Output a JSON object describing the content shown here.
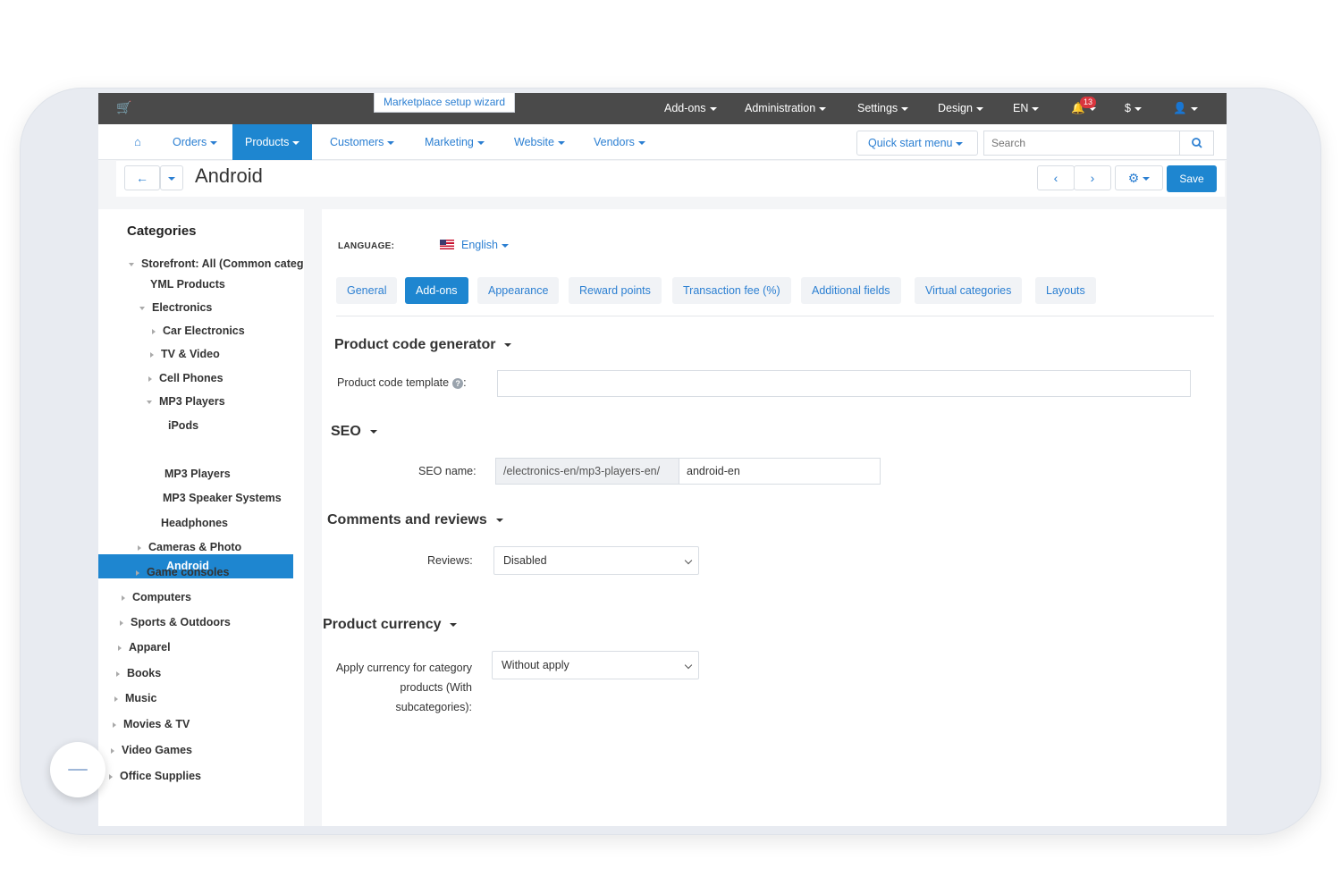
{
  "topbar": {
    "wizard": "Marketplace setup wizard",
    "menus": [
      "Add-ons",
      "Administration",
      "Settings",
      "Design",
      "EN"
    ],
    "notifications": "13",
    "currency": "$"
  },
  "nav": {
    "items": [
      "Orders",
      "Products",
      "Customers",
      "Marketing",
      "Website",
      "Vendors"
    ],
    "active": "Products",
    "quick_start": "Quick start menu",
    "search_placeholder": "Search"
  },
  "title": {
    "text": "Android",
    "save_label": "Save"
  },
  "sidebar": {
    "heading": "Categories",
    "items": [
      {
        "label": "Storefront: All (Common categ"
      },
      {
        "label": "YML Products"
      },
      {
        "label": "Electronics"
      },
      {
        "label": "Car Electronics"
      },
      {
        "label": "TV & Video"
      },
      {
        "label": "Cell Phones"
      },
      {
        "label": "MP3 Players"
      },
      {
        "label": "iPods"
      },
      {
        "label": "Android"
      },
      {
        "label": "MP3 Players"
      },
      {
        "label": "MP3 Speaker Systems"
      },
      {
        "label": "Headphones"
      },
      {
        "label": "Cameras & Photo"
      },
      {
        "label": "Game consoles"
      },
      {
        "label": "Computers"
      },
      {
        "label": "Sports & Outdoors"
      },
      {
        "label": "Apparel"
      },
      {
        "label": "Books"
      },
      {
        "label": "Music"
      },
      {
        "label": "Movies & TV"
      },
      {
        "label": "Video Games"
      },
      {
        "label": "Office Supplies"
      }
    ]
  },
  "main": {
    "language_label": "LANGUAGE:",
    "language_value": "English",
    "tabs": [
      "General",
      "Add-ons",
      "Appearance",
      "Reward points",
      "Transaction fee (%)",
      "Additional fields",
      "Virtual categories",
      "Layouts"
    ],
    "active_tab": "Add-ons",
    "sections": {
      "code_gen": "Product code generator",
      "seo": "SEO",
      "comments": "Comments and reviews",
      "currency": "Product currency"
    },
    "fields": {
      "code_template_label": "Product code template",
      "code_template_value": "",
      "seo_label": "SEO name:",
      "seo_prefix": "/electronics-en/mp3-players-en/",
      "seo_value": "android-en",
      "reviews_label": "Reviews:",
      "reviews_value": "Disabled",
      "currency_label_1": "Apply currency for category",
      "currency_label_2": "products (With",
      "currency_label_3": "subcategories):",
      "currency_value": "Without apply"
    }
  },
  "colors": {
    "accent": "#1e86d0",
    "topbar": "#4a4a4a",
    "link": "#2b7fd2"
  }
}
